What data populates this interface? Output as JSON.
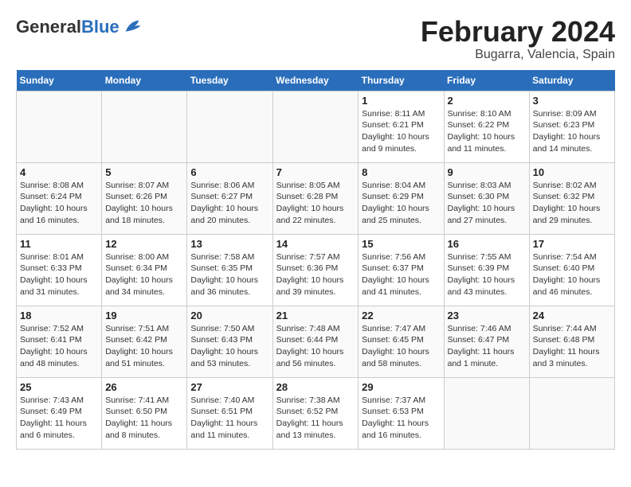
{
  "header": {
    "logo_general": "General",
    "logo_blue": "Blue",
    "month_title": "February 2024",
    "location": "Bugarra, Valencia, Spain"
  },
  "weekdays": [
    "Sunday",
    "Monday",
    "Tuesday",
    "Wednesday",
    "Thursday",
    "Friday",
    "Saturday"
  ],
  "weeks": [
    [
      {
        "day": "",
        "info": ""
      },
      {
        "day": "",
        "info": ""
      },
      {
        "day": "",
        "info": ""
      },
      {
        "day": "",
        "info": ""
      },
      {
        "day": "1",
        "info": "Sunrise: 8:11 AM\nSunset: 6:21 PM\nDaylight: 10 hours\nand 9 minutes."
      },
      {
        "day": "2",
        "info": "Sunrise: 8:10 AM\nSunset: 6:22 PM\nDaylight: 10 hours\nand 11 minutes."
      },
      {
        "day": "3",
        "info": "Sunrise: 8:09 AM\nSunset: 6:23 PM\nDaylight: 10 hours\nand 14 minutes."
      }
    ],
    [
      {
        "day": "4",
        "info": "Sunrise: 8:08 AM\nSunset: 6:24 PM\nDaylight: 10 hours\nand 16 minutes."
      },
      {
        "day": "5",
        "info": "Sunrise: 8:07 AM\nSunset: 6:26 PM\nDaylight: 10 hours\nand 18 minutes."
      },
      {
        "day": "6",
        "info": "Sunrise: 8:06 AM\nSunset: 6:27 PM\nDaylight: 10 hours\nand 20 minutes."
      },
      {
        "day": "7",
        "info": "Sunrise: 8:05 AM\nSunset: 6:28 PM\nDaylight: 10 hours\nand 22 minutes."
      },
      {
        "day": "8",
        "info": "Sunrise: 8:04 AM\nSunset: 6:29 PM\nDaylight: 10 hours\nand 25 minutes."
      },
      {
        "day": "9",
        "info": "Sunrise: 8:03 AM\nSunset: 6:30 PM\nDaylight: 10 hours\nand 27 minutes."
      },
      {
        "day": "10",
        "info": "Sunrise: 8:02 AM\nSunset: 6:32 PM\nDaylight: 10 hours\nand 29 minutes."
      }
    ],
    [
      {
        "day": "11",
        "info": "Sunrise: 8:01 AM\nSunset: 6:33 PM\nDaylight: 10 hours\nand 31 minutes."
      },
      {
        "day": "12",
        "info": "Sunrise: 8:00 AM\nSunset: 6:34 PM\nDaylight: 10 hours\nand 34 minutes."
      },
      {
        "day": "13",
        "info": "Sunrise: 7:58 AM\nSunset: 6:35 PM\nDaylight: 10 hours\nand 36 minutes."
      },
      {
        "day": "14",
        "info": "Sunrise: 7:57 AM\nSunset: 6:36 PM\nDaylight: 10 hours\nand 39 minutes."
      },
      {
        "day": "15",
        "info": "Sunrise: 7:56 AM\nSunset: 6:37 PM\nDaylight: 10 hours\nand 41 minutes."
      },
      {
        "day": "16",
        "info": "Sunrise: 7:55 AM\nSunset: 6:39 PM\nDaylight: 10 hours\nand 43 minutes."
      },
      {
        "day": "17",
        "info": "Sunrise: 7:54 AM\nSunset: 6:40 PM\nDaylight: 10 hours\nand 46 minutes."
      }
    ],
    [
      {
        "day": "18",
        "info": "Sunrise: 7:52 AM\nSunset: 6:41 PM\nDaylight: 10 hours\nand 48 minutes."
      },
      {
        "day": "19",
        "info": "Sunrise: 7:51 AM\nSunset: 6:42 PM\nDaylight: 10 hours\nand 51 minutes."
      },
      {
        "day": "20",
        "info": "Sunrise: 7:50 AM\nSunset: 6:43 PM\nDaylight: 10 hours\nand 53 minutes."
      },
      {
        "day": "21",
        "info": "Sunrise: 7:48 AM\nSunset: 6:44 PM\nDaylight: 10 hours\nand 56 minutes."
      },
      {
        "day": "22",
        "info": "Sunrise: 7:47 AM\nSunset: 6:45 PM\nDaylight: 10 hours\nand 58 minutes."
      },
      {
        "day": "23",
        "info": "Sunrise: 7:46 AM\nSunset: 6:47 PM\nDaylight: 11 hours\nand 1 minute."
      },
      {
        "day": "24",
        "info": "Sunrise: 7:44 AM\nSunset: 6:48 PM\nDaylight: 11 hours\nand 3 minutes."
      }
    ],
    [
      {
        "day": "25",
        "info": "Sunrise: 7:43 AM\nSunset: 6:49 PM\nDaylight: 11 hours\nand 6 minutes."
      },
      {
        "day": "26",
        "info": "Sunrise: 7:41 AM\nSunset: 6:50 PM\nDaylight: 11 hours\nand 8 minutes."
      },
      {
        "day": "27",
        "info": "Sunrise: 7:40 AM\nSunset: 6:51 PM\nDaylight: 11 hours\nand 11 minutes."
      },
      {
        "day": "28",
        "info": "Sunrise: 7:38 AM\nSunset: 6:52 PM\nDaylight: 11 hours\nand 13 minutes."
      },
      {
        "day": "29",
        "info": "Sunrise: 7:37 AM\nSunset: 6:53 PM\nDaylight: 11 hours\nand 16 minutes."
      },
      {
        "day": "",
        "info": ""
      },
      {
        "day": "",
        "info": ""
      }
    ]
  ]
}
